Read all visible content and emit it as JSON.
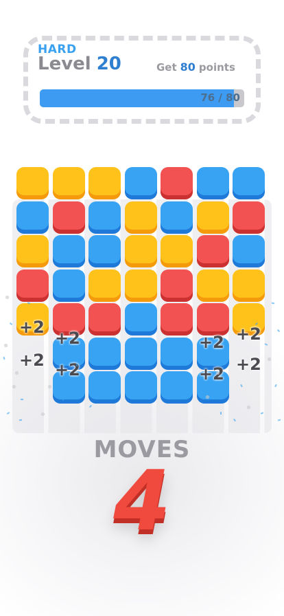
{
  "header": {
    "difficulty": "HARD",
    "level_word": "Level",
    "level_number": "20",
    "goal_prefix": "Get",
    "goal_points": "80",
    "goal_suffix": "points",
    "progress_text": "76 / 80",
    "progress_current": 76,
    "progress_target": 80
  },
  "board": {
    "rows": [
      [
        "yellow",
        "yellow",
        "yellow",
        "blue",
        "red",
        "blue",
        "blue"
      ],
      [
        "blue",
        "red",
        "blue",
        "yellow",
        "blue",
        "yellow",
        "red"
      ],
      [
        "yellow",
        "blue",
        "blue",
        "yellow",
        "yellow",
        "red",
        "blue"
      ],
      [
        "red",
        "blue",
        "yellow",
        "yellow",
        "red",
        "yellow",
        "yellow"
      ],
      [
        "yellow",
        "red",
        "red",
        "blue",
        "red",
        "red",
        "yellow"
      ],
      [
        "empty",
        "blue",
        "blue",
        "blue",
        "blue",
        "blue",
        "empty"
      ],
      [
        "empty",
        "blue",
        "blue",
        "blue",
        "blue",
        "blue",
        "empty"
      ]
    ],
    "score_popups": [
      "+2",
      "+2",
      "+2",
      "+2",
      "+2",
      "+2",
      "+2",
      "+2"
    ]
  },
  "moves": {
    "label": "MOVES",
    "count": "4"
  },
  "colors": {
    "yellow": "#ffc21a",
    "blue": "#38a3f3",
    "red": "#f25252",
    "accent": "#3d9cf2",
    "moves_number": "#f04a3e"
  }
}
